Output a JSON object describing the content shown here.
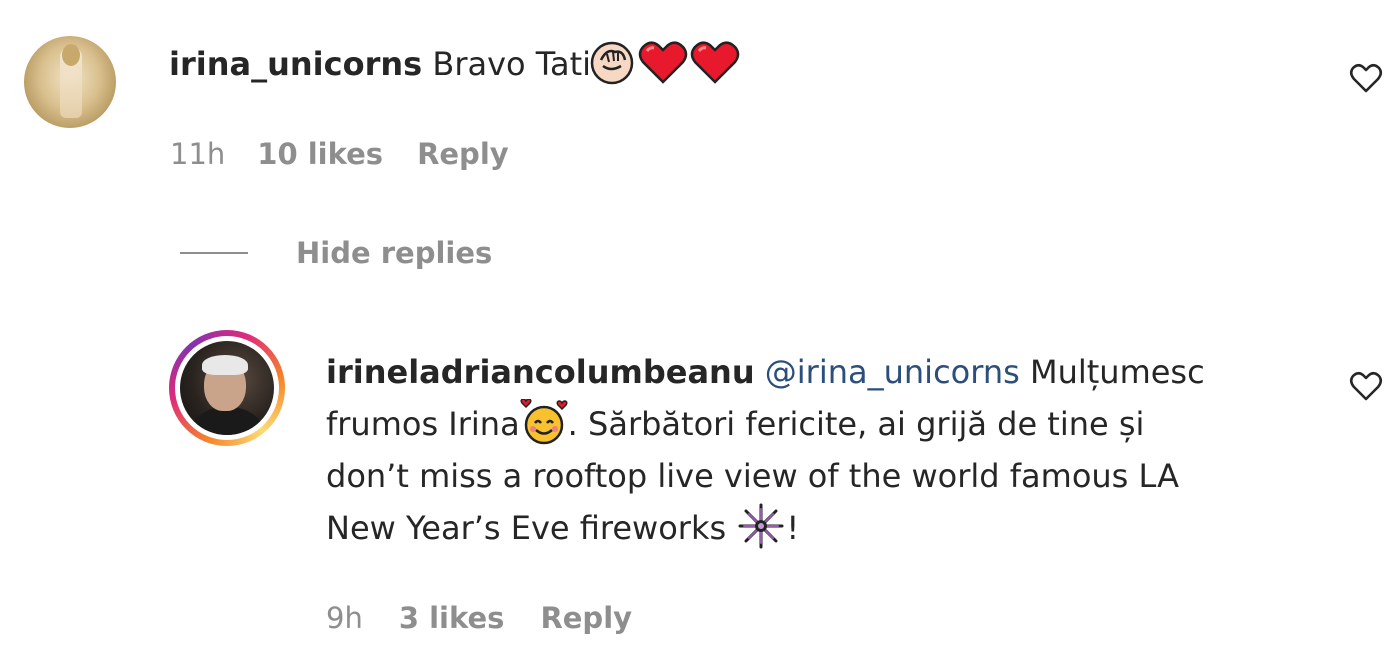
{
  "comments": [
    {
      "username": "irina_unicorns",
      "text": "Bravo Tati",
      "emojis": [
        "clapping-hands-emoji",
        "red-heart-emoji",
        "red-heart-emoji"
      ],
      "time": "11h",
      "likes": "10 likes",
      "reply_label": "Reply"
    }
  ],
  "hide_replies_label": "Hide replies",
  "replies": [
    {
      "username": "irineladriancolumbeanu",
      "mention": "@irina_unicorns",
      "line1_text": "Mulțumesc",
      "line2_start": "frumos Irina",
      "line2_end": ". Sărbători fericite, ai grijă de tine și",
      "line3": "don’t miss a rooftop live view of the world famous LA",
      "line4_start": "New Year’s Eve fireworks ",
      "line4_end": "!",
      "emojis": [
        "smiling-face-with-hearts-emoji",
        "fireworks-emoji"
      ],
      "time": "9h",
      "likes": "3 likes",
      "reply_label": "Reply"
    }
  ],
  "colors": {
    "text": "#262626",
    "secondary": "#8e8e8e",
    "mention": "#2b4f7a",
    "heart": "#e8182d"
  }
}
